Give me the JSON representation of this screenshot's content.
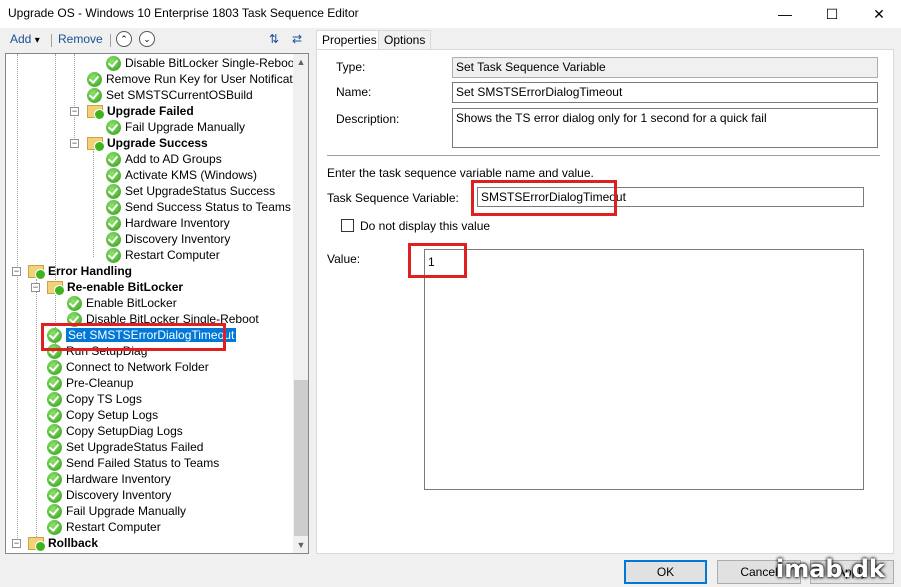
{
  "window": {
    "title": "Upgrade OS - Windows 10 Enterprise 1803 Task Sequence Editor",
    "minimize_glyph": "—",
    "maximize_glyph": "☐",
    "close_glyph": "✕"
  },
  "toolbar": {
    "add_label": "Add",
    "add_dropdown_glyph": "▾",
    "remove_label": "Remove",
    "move_up_glyph": "⌃",
    "move_down_glyph": "⌄",
    "icon1": "⇅",
    "icon2": "⇄"
  },
  "tree": {
    "rows": [
      {
        "label": "Disable BitLocker Single-Reboot",
        "icon": "check"
      },
      {
        "label": "Remove Run Key for User Notification",
        "icon": "check"
      },
      {
        "label": "Set SMSTSCurrentOSBuild",
        "icon": "check"
      },
      {
        "label": "Upgrade Failed",
        "icon": "folder"
      },
      {
        "label": "Fail Upgrade Manually",
        "icon": "check"
      },
      {
        "label": "Upgrade Success",
        "icon": "folder"
      },
      {
        "label": "Add to AD Groups",
        "icon": "check"
      },
      {
        "label": "Activate KMS (Windows)",
        "icon": "check"
      },
      {
        "label": "Set UpgradeStatus Success",
        "icon": "check"
      },
      {
        "label": "Send Success Status to Teams",
        "icon": "check"
      },
      {
        "label": "Hardware Inventory",
        "icon": "check"
      },
      {
        "label": "Discovery Inventory",
        "icon": "check"
      },
      {
        "label": "Restart Computer",
        "icon": "check"
      },
      {
        "label": "Error Handling",
        "icon": "folder"
      },
      {
        "label": "Re-enable BitLocker",
        "icon": "folder"
      },
      {
        "label": "Enable BitLocker",
        "icon": "check"
      },
      {
        "label": "Disable BitLocker Single-Reboot",
        "icon": "check"
      },
      {
        "label": "Set SMSTSErrorDialogTimeout",
        "icon": "check"
      },
      {
        "label": "Run SetupDiag",
        "icon": "check"
      },
      {
        "label": "Connect to Network Folder",
        "icon": "check"
      },
      {
        "label": "Pre-Cleanup",
        "icon": "check"
      },
      {
        "label": "Copy TS Logs",
        "icon": "check"
      },
      {
        "label": "Copy Setup Logs",
        "icon": "check"
      },
      {
        "label": "Copy SetupDiag Logs",
        "icon": "check"
      },
      {
        "label": "Set UpgradeStatus Failed",
        "icon": "check"
      },
      {
        "label": "Send Failed Status to Teams",
        "icon": "check"
      },
      {
        "label": "Hardware Inventory",
        "icon": "check"
      },
      {
        "label": "Discovery Inventory",
        "icon": "check"
      },
      {
        "label": "Fail Upgrade Manually",
        "icon": "check"
      },
      {
        "label": "Restart Computer",
        "icon": "check"
      },
      {
        "label": "Rollback",
        "icon": "folder"
      }
    ],
    "expander_glyph": "−",
    "scroll_up_glyph": "▲",
    "scroll_down_glyph": "▼"
  },
  "tabs": [
    {
      "label": "Properties",
      "active": true
    },
    {
      "label": "Options",
      "active": false
    }
  ],
  "properties": {
    "type_label": "Type:",
    "type_value": "Set Task Sequence Variable",
    "name_label": "Name:",
    "name_value": "Set SMSTSErrorDialogTimeout",
    "description_label": "Description:",
    "description_value": "Shows the TS error dialog only for 1 second for a quick fail",
    "instruction": "Enter the task sequence variable name and value.",
    "variable_label": "Task Sequence Variable:",
    "variable_value": "SMSTSErrorDialogTimeout",
    "hide_value_label": "Do not display this value",
    "hide_value_checked": false,
    "value_label": "Value:",
    "value_value": "1"
  },
  "buttons": {
    "ok": "OK",
    "cancel": "Cancel",
    "apply": "Apply"
  },
  "watermark": "imab.dk",
  "colors": {
    "highlight_box": "#e02020",
    "selection": "#0078d7"
  }
}
